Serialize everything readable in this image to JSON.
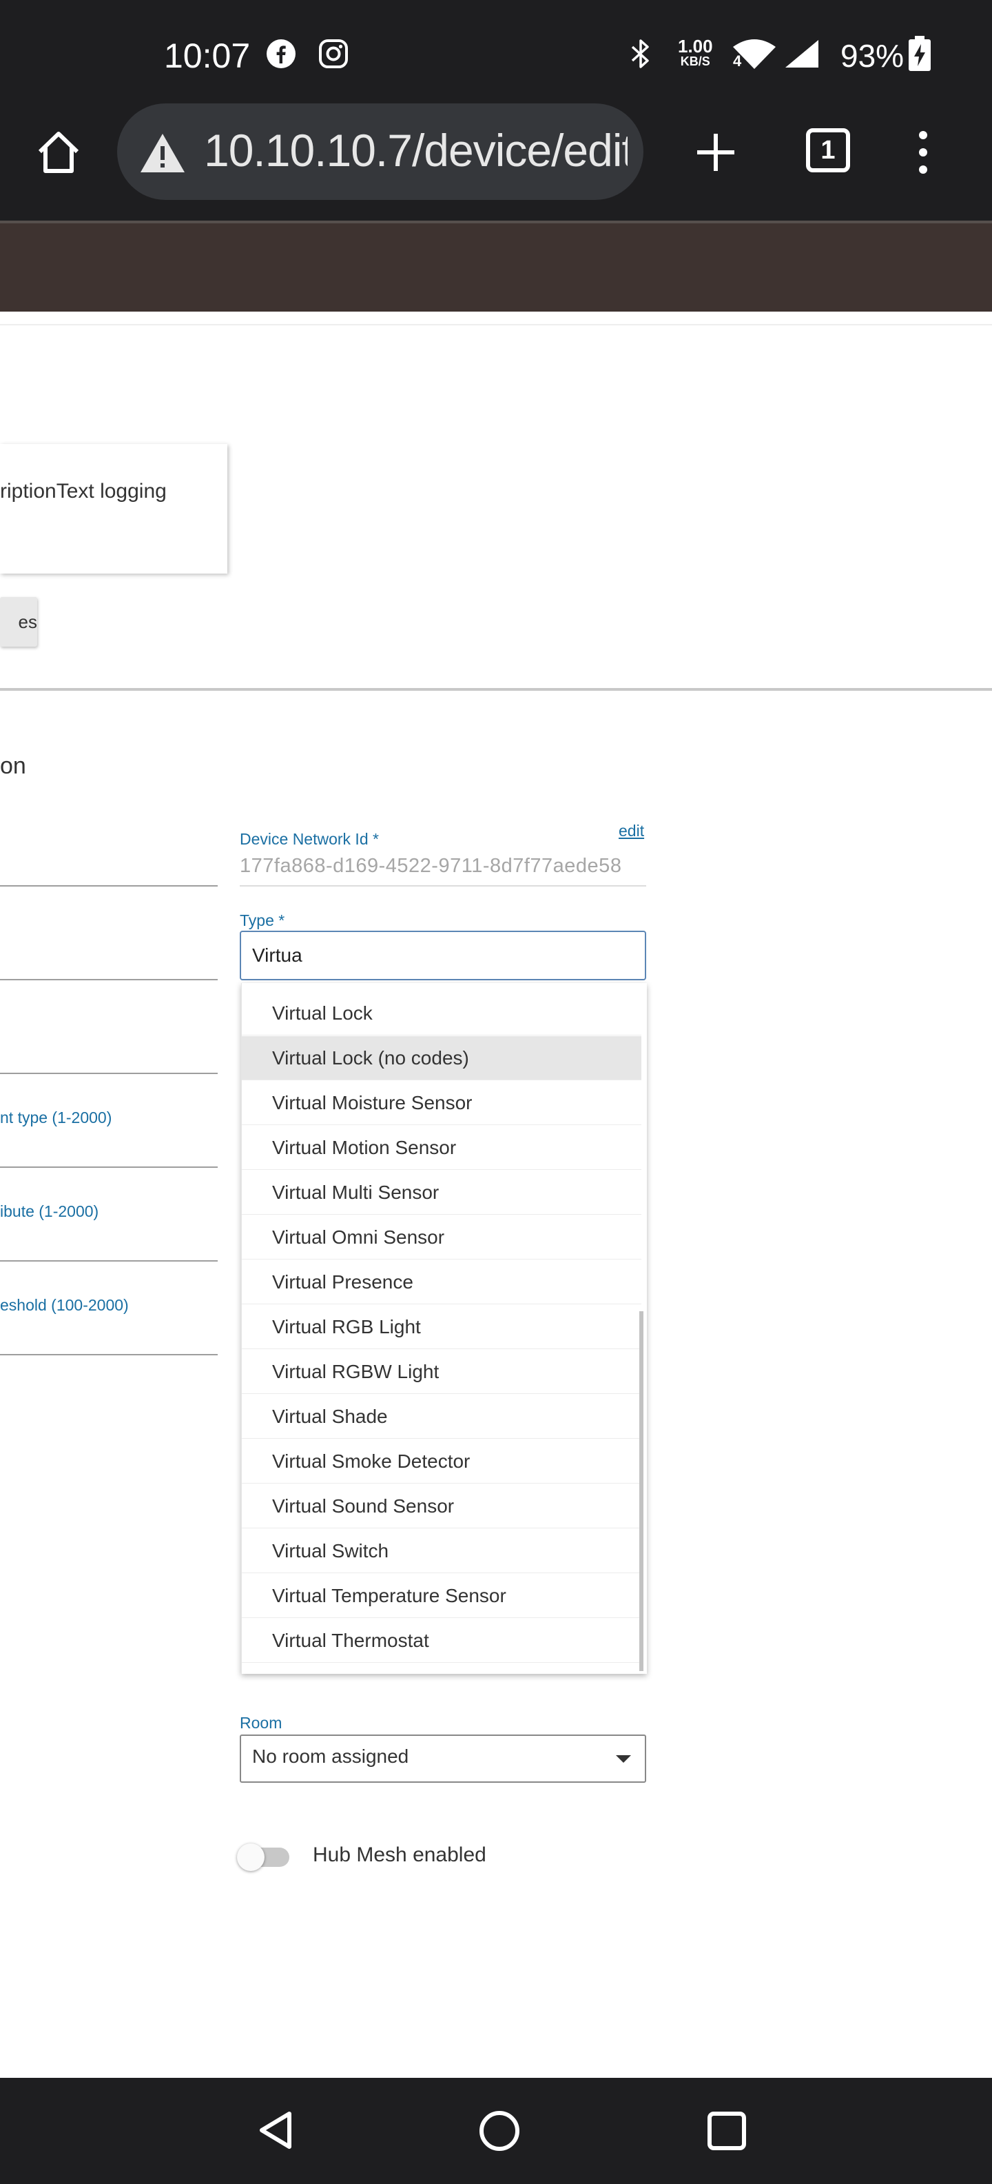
{
  "status_bar": {
    "time": "10:07",
    "speed_value": "1.00",
    "speed_unit": "KB/S",
    "network_type": "4",
    "battery_pct": "93%",
    "icons": [
      "facebook-icon",
      "instagram-icon",
      "bluetooth-icon",
      "wifi-icon",
      "signal-icon",
      "battery-charging-icon"
    ]
  },
  "browser": {
    "url": "10.10.10.7/device/edit",
    "tab_count": "1",
    "icons": [
      "home-icon",
      "warning-icon",
      "new-tab-icon",
      "tabs-icon",
      "more-menu-icon"
    ]
  },
  "preferences": {
    "logging_label": "riptionText logging",
    "save_button": "es"
  },
  "device_info": {
    "section_title": "on",
    "left_labels": [
      "nt type (1-2000)",
      "ibute (1-2000)",
      "eshold (100-2000)"
    ],
    "network_id_label": "Device Network Id *",
    "network_id_value": "177fa868-d169-4522-9711-8d7f77aede58",
    "edit_link": "edit",
    "type_label": "Type *",
    "type_value": "Virtua",
    "type_options": [
      "Virtual Lock",
      "Virtual Lock (no codes)",
      "Virtual Moisture Sensor",
      "Virtual Motion Sensor",
      "Virtual Multi Sensor",
      "Virtual Omni Sensor",
      "Virtual Presence",
      "Virtual RGB Light",
      "Virtual RGBW Light",
      "Virtual Shade",
      "Virtual Smoke Detector",
      "Virtual Sound Sensor",
      "Virtual Switch",
      "Virtual Temperature Sensor",
      "Virtual Thermostat"
    ],
    "highlighted_option": "Virtual Lock (no codes)",
    "room_label": "Room",
    "room_value": "No room assigned",
    "hub_mesh_label": "Hub Mesh enabled",
    "hub_mesh_enabled": false
  },
  "colors": {
    "accent_blue": "#1a6fa3",
    "header_brown": "#3e3330",
    "system_bar": "#1e1e20"
  }
}
